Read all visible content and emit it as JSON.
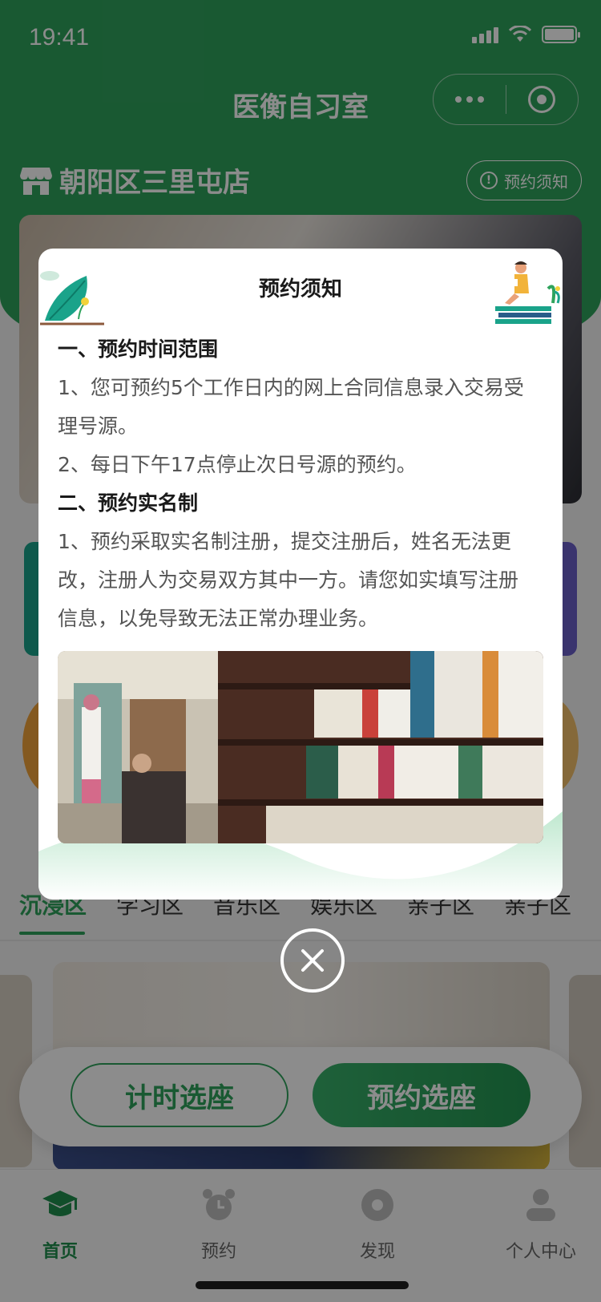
{
  "status_bar": {
    "time": "19:41"
  },
  "nav": {
    "title": "医衡自习室"
  },
  "store": {
    "name": "朝阳区三里屯店",
    "notice_button": "预约须知"
  },
  "zone_tabs": [
    {
      "label": "沉浸区"
    },
    {
      "label": "学习区"
    },
    {
      "label": "音乐区"
    },
    {
      "label": "娱乐区"
    },
    {
      "label": "亲子区"
    },
    {
      "label": "亲子区"
    }
  ],
  "actions": {
    "timer_label": "计时选座",
    "reserve_label": "预约选座"
  },
  "tabbar": [
    {
      "label": "首页",
      "icon": "graduation-cap-icon"
    },
    {
      "label": "预约",
      "icon": "alarm-clock-icon"
    },
    {
      "label": "发现",
      "icon": "disc-icon"
    },
    {
      "label": "个人中心",
      "icon": "person-icon"
    }
  ],
  "modal": {
    "title": "预约须知",
    "sections": [
      {
        "heading": "一、预约时间范围",
        "lines": [
          "1、您可预约5个工作日内的网上合同信息录入交易受",
          "理号源。",
          "2、每日下午17点停止次日号源的预约。"
        ]
      },
      {
        "heading": "二、预约实名制",
        "lines": [
          "1、预约采取实名制注册，提交注册后，姓名无法更",
          "改，注册人为交易双方其中一方。请您如实填写注册",
          "信息，以免导致无法正常办理业务。"
        ]
      }
    ]
  },
  "colors": {
    "primary": "#2fa35c",
    "text_dark": "#1a1a1a",
    "text_body": "#555555"
  }
}
